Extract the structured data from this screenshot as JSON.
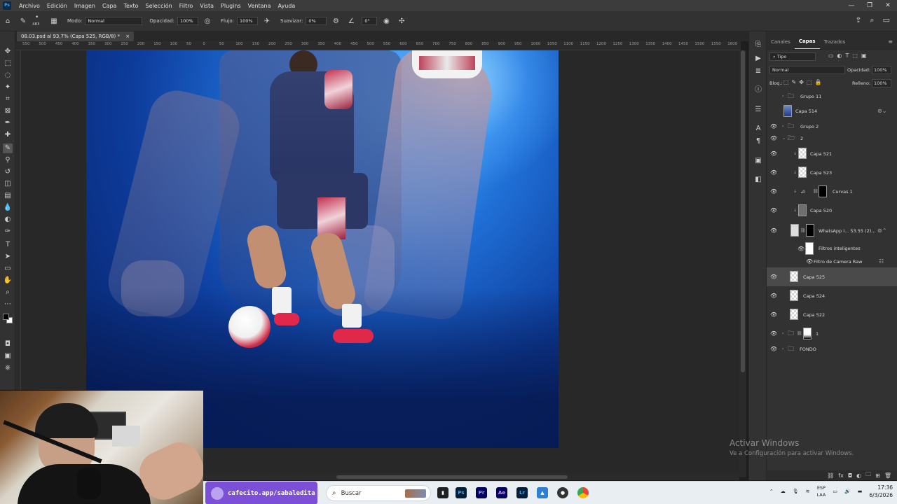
{
  "menubar": {
    "items": [
      "Archivo",
      "Edición",
      "Imagen",
      "Capa",
      "Texto",
      "Selección",
      "Filtro",
      "Vista",
      "Plugins",
      "Ventana",
      "Ayuda"
    ],
    "window_controls": [
      "—",
      "❐",
      "✕"
    ]
  },
  "options": {
    "brush_size": "483",
    "mode_label": "Modo:",
    "mode_value": "Normal",
    "opacity_label": "Opacidad:",
    "opacity_value": "100%",
    "flow_label": "Flujo:",
    "flow_value": "100%",
    "smooth_label": "Suavizar:",
    "smooth_value": "0%",
    "angle_value": "0°"
  },
  "document": {
    "tab_title": "08.03.psd al 93,7% (Capa 525, RGB/8) *",
    "tab_close": "×"
  },
  "ruler": {
    "ticks": [
      "550",
      "500",
      "450",
      "400",
      "350",
      "300",
      "250",
      "200",
      "150",
      "100",
      "50",
      "0",
      "50",
      "100",
      "150",
      "200",
      "250",
      "300",
      "350",
      "400",
      "450",
      "500",
      "550",
      "600",
      "650",
      "700",
      "750",
      "800",
      "850",
      "900",
      "950",
      "1000",
      "1050",
      "1100",
      "1150",
      "1200",
      "1250",
      "1300",
      "1350",
      "1400",
      "1450",
      "1500",
      "1550",
      "1600"
    ]
  },
  "panels": {
    "tabs": [
      "Canales",
      "Capas",
      "Trazados"
    ],
    "filter_kind": "Tipo",
    "blend_mode": "Normal",
    "opacity_label": "Opacidad:",
    "opacity_value": "100%",
    "lock_label": "Bloq.:",
    "fill_label": "Relleno:",
    "fill_value": "100%"
  },
  "layers": [
    {
      "name": "Grupo 11",
      "type": "group",
      "visible": false,
      "collapsed": true
    },
    {
      "name": "Capa 514",
      "type": "smart",
      "visible": false
    },
    {
      "name": "Grupo 2",
      "type": "group",
      "visible": true,
      "collapsed": true
    },
    {
      "name": "2",
      "type": "group",
      "visible": true,
      "collapsed": false
    },
    {
      "name": "Capa 521",
      "type": "pixel",
      "visible": true,
      "clipped": true
    },
    {
      "name": "Capa 523",
      "type": "pixel",
      "visible": true,
      "clipped": true
    },
    {
      "name": "Curvas 1",
      "type": "adjustment",
      "visible": true,
      "clipped": true
    },
    {
      "name": "Capa 520",
      "type": "pixel",
      "visible": true,
      "clipped": true
    },
    {
      "name": "WhatsApp I... 53.55 (2)...",
      "type": "smart",
      "visible": true
    },
    {
      "name": "Filtros inteligentes",
      "type": "filter-group",
      "visible": true
    },
    {
      "name": "Filtro de Camera Raw",
      "type": "filter",
      "visible": true
    },
    {
      "name": "Capa 525",
      "type": "pixel",
      "visible": true,
      "selected": true
    },
    {
      "name": "Capa 524",
      "type": "pixel",
      "visible": true
    },
    {
      "name": "Capa 522",
      "type": "pixel",
      "visible": true
    },
    {
      "name": "1",
      "type": "group",
      "visible": true,
      "collapsed": true
    },
    {
      "name": "FONDO",
      "type": "group",
      "visible": true,
      "collapsed": true
    }
  ],
  "watermark": {
    "title": "Activar Windows",
    "subtitle": "Ve a Configuración para activar Windows."
  },
  "taskbar": {
    "promo_text": "cafecito.app/sabaledita",
    "search_placeholder": "Buscar",
    "apps": [
      "Ps",
      "Pr",
      "Ae",
      "Lr"
    ],
    "lang_line1": "ESP",
    "lang_line2": "LAA",
    "time": "17:36",
    "date": "6/3/2026"
  },
  "colors": {
    "ps_blue": "#31a8ff",
    "canvas_blue": "#1f6fd6",
    "promo_purple": "#7b4fd6"
  }
}
